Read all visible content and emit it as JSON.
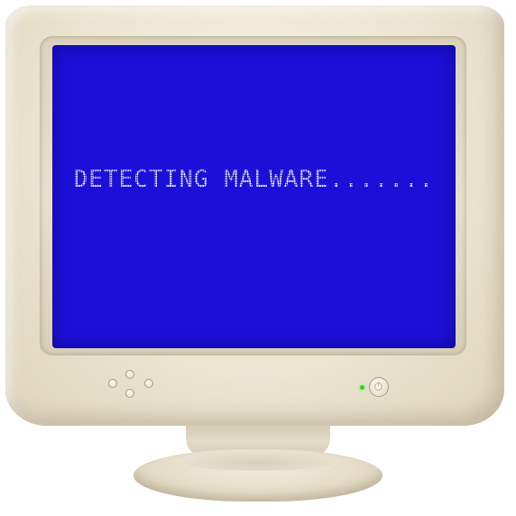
{
  "screen": {
    "message": "DETECTING MALWARE.......",
    "background_color": "#1c10d8",
    "text_color": "#ffffff"
  },
  "monitor": {
    "casing_color": "#ede5d1",
    "power_led_color": "#2bd12b",
    "front_buttons": [
      "left-button",
      "top-button",
      "right-button",
      "bottom-button"
    ],
    "icons": [
      "power-icon"
    ]
  }
}
